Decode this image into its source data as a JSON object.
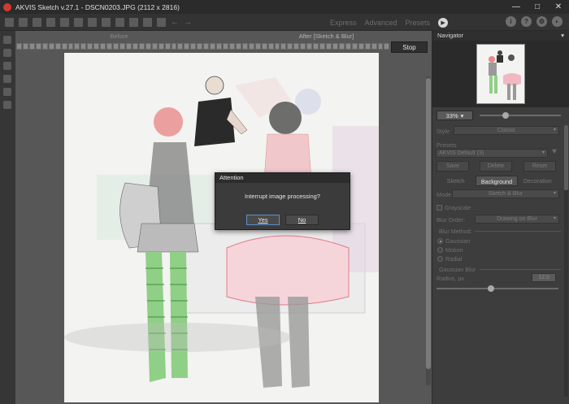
{
  "window": {
    "title": "AKVIS Sketch v.27.1 - DSCN0203.JPG (2112 x 2816)",
    "minimize": "—",
    "maximize": "□",
    "close": "✕"
  },
  "toolbar": {
    "modes": [
      "Express",
      "Advanced",
      "Presets"
    ],
    "run": "▶",
    "undo": "←",
    "redo": "→",
    "info": "i",
    "help": "?"
  },
  "canvas": {
    "before_label": "Before",
    "after_label": "After [Sketch & Blur]",
    "stop_label": "Stop",
    "progress": 0.0
  },
  "dialog": {
    "title": "Attention",
    "message": "Interrupt image processing?",
    "yes": "Yes",
    "no": "No"
  },
  "panel": {
    "navigator_title": "Navigator",
    "zoom": "33%",
    "style_label": "Style:",
    "style_value": "Classic",
    "presets_label": "Presets",
    "preset_value": "AKVIS Default (3)",
    "save": "Save",
    "delete": "Delete",
    "reset": "Reset",
    "tabs": [
      "Sketch",
      "Background",
      "Decoration"
    ],
    "mode_label": "Mode:",
    "mode_value": "Sketch & Blur",
    "grayscale": "Grayscale",
    "blur_order_label": "Blur Order:",
    "blur_order_value": "Drawing on Blur",
    "blur_method_label": "Blur Method:",
    "methods": [
      "Gaussian",
      "Motion",
      "Radial"
    ],
    "gaussian_blur_label": "Gaussian Blur",
    "radius_label": "Radius, px",
    "radius_value": "12.0"
  }
}
